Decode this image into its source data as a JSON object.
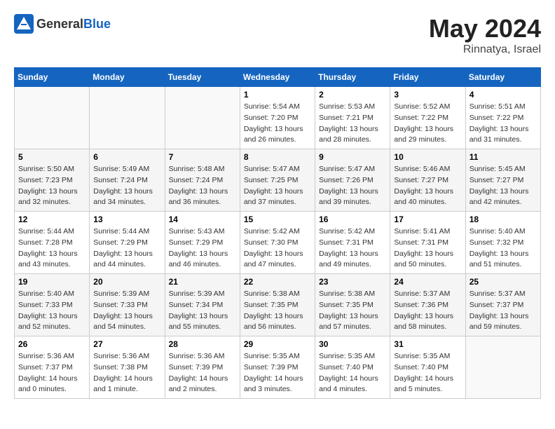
{
  "header": {
    "logo_general": "General",
    "logo_blue": "Blue",
    "month_year": "May 2024",
    "location": "Rinnatya, Israel"
  },
  "weekdays": [
    "Sunday",
    "Monday",
    "Tuesday",
    "Wednesday",
    "Thursday",
    "Friday",
    "Saturday"
  ],
  "weeks": [
    [
      {
        "day": "",
        "empty": true
      },
      {
        "day": "",
        "empty": true
      },
      {
        "day": "",
        "empty": true
      },
      {
        "day": "1",
        "sunrise": "5:54 AM",
        "sunset": "7:20 PM",
        "daylight": "13 hours and 26 minutes."
      },
      {
        "day": "2",
        "sunrise": "5:53 AM",
        "sunset": "7:21 PM",
        "daylight": "13 hours and 28 minutes."
      },
      {
        "day": "3",
        "sunrise": "5:52 AM",
        "sunset": "7:22 PM",
        "daylight": "13 hours and 29 minutes."
      },
      {
        "day": "4",
        "sunrise": "5:51 AM",
        "sunset": "7:22 PM",
        "daylight": "13 hours and 31 minutes."
      }
    ],
    [
      {
        "day": "5",
        "sunrise": "5:50 AM",
        "sunset": "7:23 PM",
        "daylight": "13 hours and 32 minutes."
      },
      {
        "day": "6",
        "sunrise": "5:49 AM",
        "sunset": "7:24 PM",
        "daylight": "13 hours and 34 minutes."
      },
      {
        "day": "7",
        "sunrise": "5:48 AM",
        "sunset": "7:24 PM",
        "daylight": "13 hours and 36 minutes."
      },
      {
        "day": "8",
        "sunrise": "5:47 AM",
        "sunset": "7:25 PM",
        "daylight": "13 hours and 37 minutes."
      },
      {
        "day": "9",
        "sunrise": "5:47 AM",
        "sunset": "7:26 PM",
        "daylight": "13 hours and 39 minutes."
      },
      {
        "day": "10",
        "sunrise": "5:46 AM",
        "sunset": "7:27 PM",
        "daylight": "13 hours and 40 minutes."
      },
      {
        "day": "11",
        "sunrise": "5:45 AM",
        "sunset": "7:27 PM",
        "daylight": "13 hours and 42 minutes."
      }
    ],
    [
      {
        "day": "12",
        "sunrise": "5:44 AM",
        "sunset": "7:28 PM",
        "daylight": "13 hours and 43 minutes."
      },
      {
        "day": "13",
        "sunrise": "5:44 AM",
        "sunset": "7:29 PM",
        "daylight": "13 hours and 44 minutes."
      },
      {
        "day": "14",
        "sunrise": "5:43 AM",
        "sunset": "7:29 PM",
        "daylight": "13 hours and 46 minutes."
      },
      {
        "day": "15",
        "sunrise": "5:42 AM",
        "sunset": "7:30 PM",
        "daylight": "13 hours and 47 minutes."
      },
      {
        "day": "16",
        "sunrise": "5:42 AM",
        "sunset": "7:31 PM",
        "daylight": "13 hours and 49 minutes."
      },
      {
        "day": "17",
        "sunrise": "5:41 AM",
        "sunset": "7:31 PM",
        "daylight": "13 hours and 50 minutes."
      },
      {
        "day": "18",
        "sunrise": "5:40 AM",
        "sunset": "7:32 PM",
        "daylight": "13 hours and 51 minutes."
      }
    ],
    [
      {
        "day": "19",
        "sunrise": "5:40 AM",
        "sunset": "7:33 PM",
        "daylight": "13 hours and 52 minutes."
      },
      {
        "day": "20",
        "sunrise": "5:39 AM",
        "sunset": "7:33 PM",
        "daylight": "13 hours and 54 minutes."
      },
      {
        "day": "21",
        "sunrise": "5:39 AM",
        "sunset": "7:34 PM",
        "daylight": "13 hours and 55 minutes."
      },
      {
        "day": "22",
        "sunrise": "5:38 AM",
        "sunset": "7:35 PM",
        "daylight": "13 hours and 56 minutes."
      },
      {
        "day": "23",
        "sunrise": "5:38 AM",
        "sunset": "7:35 PM",
        "daylight": "13 hours and 57 minutes."
      },
      {
        "day": "24",
        "sunrise": "5:37 AM",
        "sunset": "7:36 PM",
        "daylight": "13 hours and 58 minutes."
      },
      {
        "day": "25",
        "sunrise": "5:37 AM",
        "sunset": "7:37 PM",
        "daylight": "13 hours and 59 minutes."
      }
    ],
    [
      {
        "day": "26",
        "sunrise": "5:36 AM",
        "sunset": "7:37 PM",
        "daylight": "14 hours and 0 minutes."
      },
      {
        "day": "27",
        "sunrise": "5:36 AM",
        "sunset": "7:38 PM",
        "daylight": "14 hours and 1 minute."
      },
      {
        "day": "28",
        "sunrise": "5:36 AM",
        "sunset": "7:39 PM",
        "daylight": "14 hours and 2 minutes."
      },
      {
        "day": "29",
        "sunrise": "5:35 AM",
        "sunset": "7:39 PM",
        "daylight": "14 hours and 3 minutes."
      },
      {
        "day": "30",
        "sunrise": "5:35 AM",
        "sunset": "7:40 PM",
        "daylight": "14 hours and 4 minutes."
      },
      {
        "day": "31",
        "sunrise": "5:35 AM",
        "sunset": "7:40 PM",
        "daylight": "14 hours and 5 minutes."
      },
      {
        "day": "",
        "empty": true
      }
    ]
  ]
}
